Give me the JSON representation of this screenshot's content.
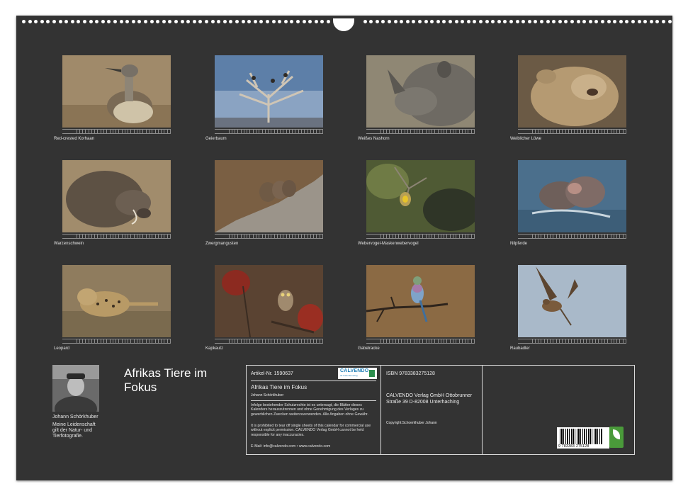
{
  "calendar": {
    "title": "Afrikas Tiere im Fokus",
    "author_name": "Johann Schörkhuber",
    "author_bio": "Meine Leidenschaft gilt der Natur- und Tierfotografie."
  },
  "months": [
    {
      "caption": "Red-crested Korhaan",
      "photo_icon": "korhaan-photo"
    },
    {
      "caption": "Geierbaum",
      "photo_icon": "vulture-tree-photo"
    },
    {
      "caption": "Weißes Nashorn",
      "photo_icon": "rhino-photo"
    },
    {
      "caption": "Weiblicher Löwe",
      "photo_icon": "lioness-photo"
    },
    {
      "caption": "Warzenschwein",
      "photo_icon": "warthog-photo"
    },
    {
      "caption": "Zwergmangusten",
      "photo_icon": "mongoose-photo"
    },
    {
      "caption": "Webervogel-Maskenwebervogel",
      "photo_icon": "weaver-photo"
    },
    {
      "caption": "Nilpferde",
      "photo_icon": "hippo-photo"
    },
    {
      "caption": "Leopard",
      "photo_icon": "leopard-photo"
    },
    {
      "caption": "Kapkautz",
      "photo_icon": "owl-photo"
    },
    {
      "caption": "Gabelracke",
      "photo_icon": "roller-photo"
    },
    {
      "caption": "Raubadler",
      "photo_icon": "eagle-photo"
    }
  ],
  "info": {
    "article_no": "Artikel-Nr. 1590637",
    "logo_text": "CALVENDO",
    "logo_sub": "Ihr Kalenderverlag",
    "product_title": "Afrikas Tiere im Fokus",
    "product_author": "Johann Schörkhuber",
    "legal_de": "Infolge bestehender Schutzrechte ist es untersagt, die Blätter dieses Kalenders herauszutrennen und ohne Genehmigung des Verlages zu gewerblichen Zwecken weiterzuverwenden. Alle Angaben ohne Gewähr.",
    "legal_en": "It is prohibited to tear off single sheets of this calendar for commercial use without explicit permission. CALVENDO Verlag GmbH cannot be held responsible for any inaccuracies.",
    "contact": "E-Mail: info@calvendo.com • www.calvendo.com",
    "isbn": "ISBN 9783383275128",
    "publisher": "CALVENDO Verlag GmbH Ottobrunner Straße 39 D-82008 Unterhaching",
    "copyright": "Copyright:Schoerkhuber Johann",
    "barcode_digits": "9 783383 275128"
  },
  "colors": {
    "sheet": "#333333",
    "text": "#e6e6e6",
    "logo_blue": "#1f7fb8",
    "eco_green": "#4a9a3a"
  }
}
